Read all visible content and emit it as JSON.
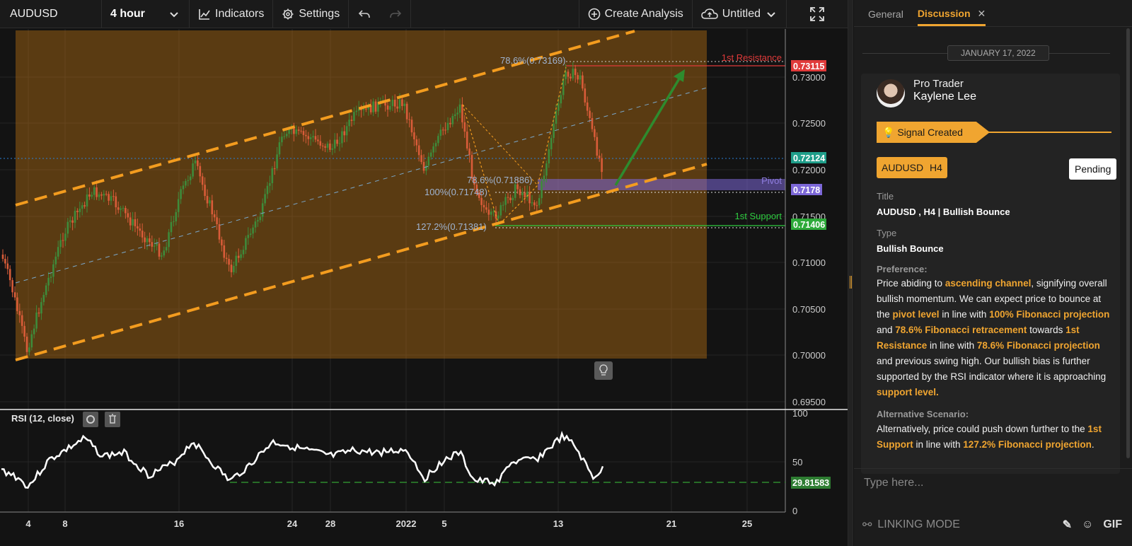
{
  "toolbar": {
    "symbol": "AUDUSD",
    "interval": "4 hour",
    "indicators_label": "Indicators",
    "settings_label": "Settings",
    "create_analysis_label": "Create Analysis",
    "layout_name": "Untitled"
  },
  "chart": {
    "price_ticks": [
      "0.73000",
      "0.72500",
      "0.72000",
      "0.71500",
      "0.71000",
      "0.70500",
      "0.70000",
      "0.69500"
    ],
    "x_ticks": [
      "4",
      "8",
      "16",
      "24",
      "28",
      "2022",
      "5",
      "13",
      "21",
      "25"
    ],
    "price_tags": {
      "resistance": "0.73115",
      "current": "0.72124",
      "pivot": "0.7178",
      "support": "0.71406"
    },
    "levels": {
      "resistance_label": "1st Resistance",
      "pivot_label": "Pivot",
      "support_label": "1st Support"
    },
    "fib_labels": {
      "top": "78.6%(0.73169)",
      "mid": "78.6%(0.71886)",
      "hundred": "100%(0.71748)",
      "ext": "127.2%(0.71381)"
    },
    "rsi": {
      "title": "RSI (12, close)",
      "ticks": [
        "100",
        "50",
        "0"
      ],
      "tag": "29.81583"
    },
    "colors": {
      "channel": "#f39c1f",
      "bull": "#3e8b3a",
      "bear": "#d95c39",
      "resistance": "#e03a3a",
      "support": "#2ecc40",
      "pivot": "#7d68d8",
      "current": "#1f9e8a"
    }
  },
  "panel": {
    "tabs": [
      "General",
      "Discussion"
    ],
    "date": "JANUARY 17, 2022",
    "author_role": "Pro Trader",
    "author_name": "Kaylene Lee",
    "signal": "Signal Created",
    "chips": [
      "AUDUSD",
      "H4"
    ],
    "status": "Pending",
    "title_label": "Title",
    "title_value": "AUDUSD , H4 | Bullish Bounce",
    "type_label": "Type",
    "type_value": "Bullish Bounce",
    "preference_label": "Preference:",
    "preference": {
      "t1": "Price abiding to ",
      "h1": "ascending channel",
      "t2": ", signifying overall bullish momentum. We can expect price to bounce at the ",
      "h2": "pivot level",
      "t3": " in line with ",
      "h3": "100% Fibonacci projection",
      "t4": " and ",
      "h4": "78.6% Fibonacci retracement",
      "t5": " towards ",
      "h5": "1st Resistance",
      "t6": " in line with ",
      "h6": "78.6% Fibonacci projection",
      "t7": " and previous swing high. Our bullish bias is further supported by the RSI indicator where it is approaching ",
      "h7": "support level."
    },
    "alt_label": "Alternative Scenario:",
    "alt": {
      "t1": "Alternatively, price could push down further to the ",
      "h1": "1st Support",
      "t2": " in line with ",
      "h2": "127.2% Fibonacci projection",
      "t3": "."
    },
    "input_placeholder": "Type here...",
    "linking_mode": "LINKING MODE",
    "gif_label": "GIF"
  }
}
